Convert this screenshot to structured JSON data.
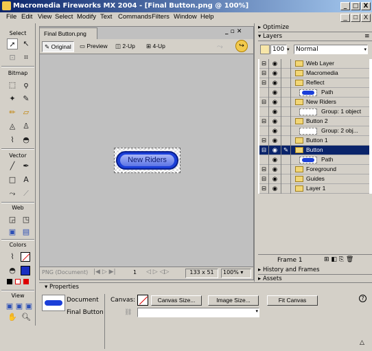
{
  "window": {
    "title": "Macromedia Fireworks MX 2004 - [Final Button.png @ 100%]",
    "min": "_",
    "max": "□",
    "close": "X"
  },
  "menu": [
    "File",
    "Edit",
    "View",
    "Select",
    "Modify",
    "Text",
    "Commands",
    "Filters",
    "Window",
    "Help"
  ],
  "tools": {
    "select": "Select",
    "bitmap": "Bitmap",
    "vector": "Vector",
    "web": "Web",
    "colors": "Colors",
    "view": "View"
  },
  "document": {
    "tab": "Final Button.png",
    "views": [
      "Original",
      "Preview",
      "2-Up",
      "4-Up"
    ],
    "button_text": "New Riders",
    "status_format": "PNG (Document)",
    "page": "1",
    "size": "133 x 51",
    "zoom": "100%"
  },
  "right": {
    "optimize": "Optimize",
    "layers": "Layers",
    "opacity": "100",
    "blend": "Normal",
    "layers_list": [
      {
        "name": "Web Layer",
        "kind": "folder",
        "indent": 0
      },
      {
        "name": "Macromedia",
        "kind": "folder",
        "indent": 0
      },
      {
        "name": "Reflect",
        "kind": "folder",
        "indent": 0
      },
      {
        "name": "Path",
        "kind": "object",
        "indent": 1
      },
      {
        "name": "New Riders",
        "kind": "folder",
        "indent": 0
      },
      {
        "name": "Group: 1 object",
        "kind": "object",
        "indent": 1
      },
      {
        "name": "Button 2",
        "kind": "folder",
        "indent": 0
      },
      {
        "name": "Group: 2 obj...",
        "kind": "object",
        "indent": 1
      },
      {
        "name": "Button 1",
        "kind": "folder",
        "indent": 0
      },
      {
        "name": "Button",
        "kind": "folder",
        "indent": 0,
        "selected": true
      },
      {
        "name": "Path",
        "kind": "object",
        "indent": 1
      },
      {
        "name": "Foreground",
        "kind": "folder",
        "indent": 0
      },
      {
        "name": "Guides",
        "kind": "folder",
        "indent": 0
      },
      {
        "name": "Layer 1",
        "kind": "folder",
        "indent": 0
      }
    ],
    "frame": "Frame 1",
    "history": "History and Frames",
    "assets": "Assets"
  },
  "properties": {
    "title": "Properties",
    "type": "Document",
    "name": "Final Button",
    "canvas_label": "Canvas:",
    "canvas_size": "Canvas Size...",
    "image_size": "Image Size...",
    "fit_canvas": "Fit Canvas"
  }
}
